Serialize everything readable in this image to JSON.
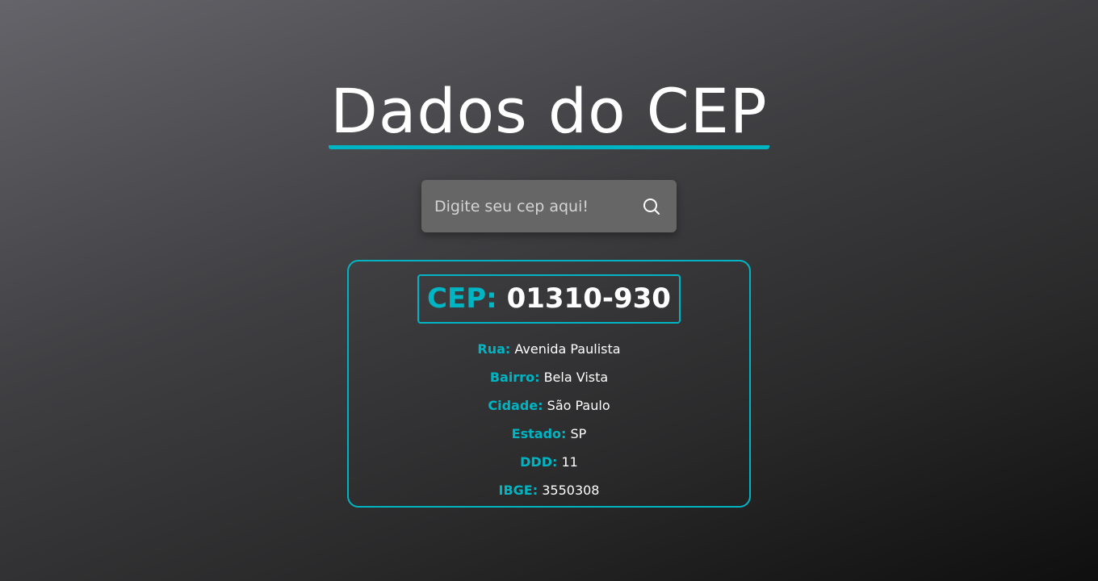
{
  "page": {
    "title": "Dados do CEP"
  },
  "search": {
    "placeholder": "Digite seu cep aqui!",
    "value": "",
    "icon": "search-icon"
  },
  "result": {
    "cep_label": "CEP:",
    "cep_value": "01310-930",
    "fields": {
      "rua": {
        "label": "Rua:",
        "value": "Avenida Paulista"
      },
      "bairro": {
        "label": "Bairro:",
        "value": "Bela Vista"
      },
      "cidade": {
        "label": "Cidade:",
        "value": "São Paulo"
      },
      "estado": {
        "label": "Estado:",
        "value": "SP"
      },
      "ddd": {
        "label": "DDD:",
        "value": "11"
      },
      "ibge": {
        "label": "IBGE:",
        "value": "3550308"
      }
    }
  },
  "colors": {
    "accent": "#00b5c3",
    "input_bg": "#666666",
    "text": "#ffffff"
  }
}
